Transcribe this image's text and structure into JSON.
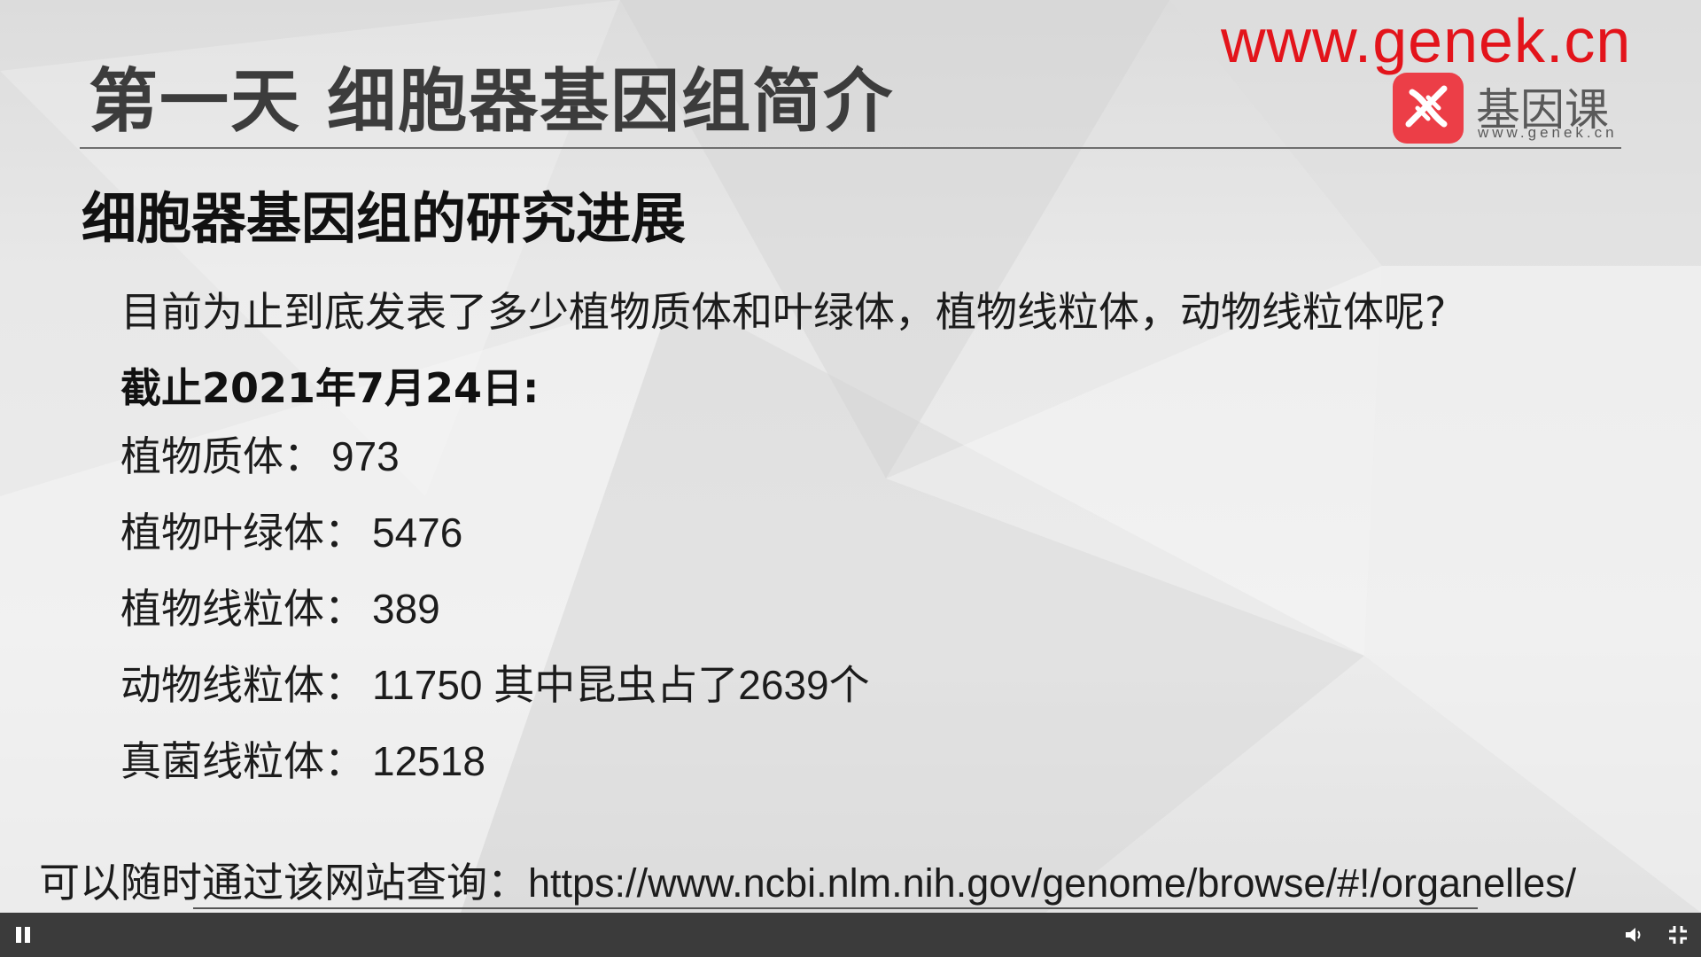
{
  "slide": {
    "title": "第一天   细胞器基因组简介",
    "watermark": "www.genek.cn",
    "logo": {
      "name": "基因课",
      "url": "www.genek.cn"
    },
    "subtitle": "细胞器基因组的研究进展",
    "question": "目前为止到底发表了多少植物质体和叶绿体，植物线粒体，动物线粒体呢?",
    "as_of": "截止2021年7月24日:",
    "stats": [
      {
        "label": "植物质体：",
        "value": "973"
      },
      {
        "label": "植物叶绿体：",
        "value": "5476"
      },
      {
        "label": "植物线粒体：",
        "value": "389"
      },
      {
        "label": "动物线粒体：",
        "value": "11750 其中昆虫占了2639个"
      },
      {
        "label": "真菌线粒体：",
        "value": "12518"
      }
    ],
    "footer": {
      "prefix": "可以随时通过该网站查询：",
      "url": "https://www.ncbi.nlm.nih.gov/genome/browse/#!/organelles/"
    }
  },
  "player": {
    "pause_icon": "pause-icon",
    "volume_icon": "volume-icon",
    "fullscreen_icon": "fullscreen-icon"
  },
  "colors": {
    "watermark": "#e3141b",
    "logo_badge": "#ec3e47",
    "player_bar": "#3b3b3b"
  }
}
